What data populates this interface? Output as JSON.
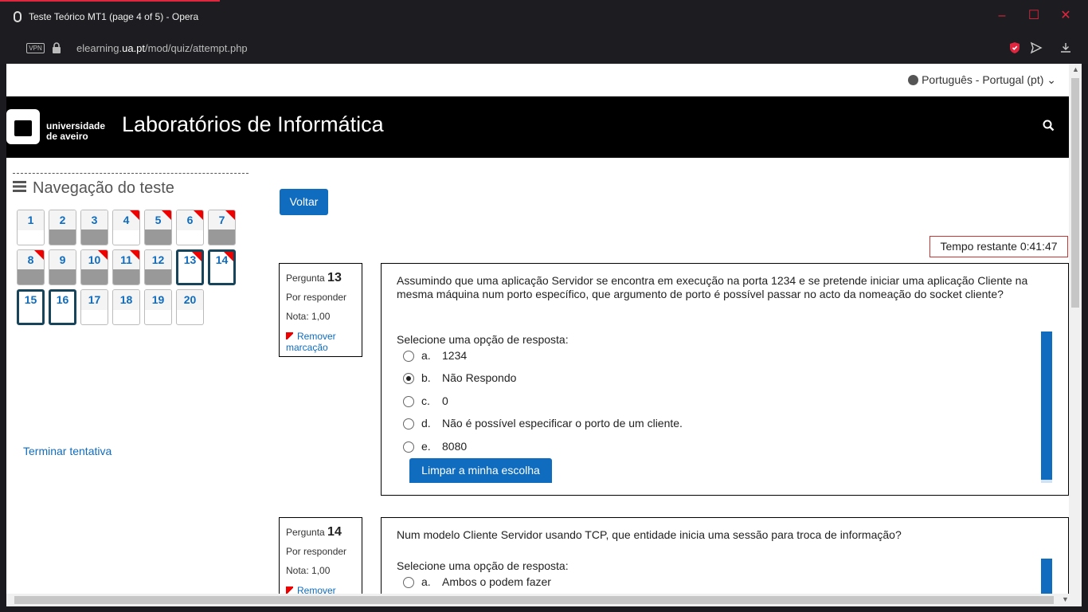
{
  "window": {
    "title": "Teste Teórico MT1 (page 4 of 5) - Opera",
    "controls": [
      "minimize",
      "maximize",
      "close"
    ]
  },
  "browser": {
    "vpn_label": "VPN",
    "url_host": "elearning.",
    "url_domain": "ua.pt",
    "url_path": "/mod/quiz/attempt.php"
  },
  "colors": {
    "accent": "#0f6cbf",
    "opera_red": "#e0253e",
    "header_bg": "#000000",
    "answered_fill": "#999999",
    "flag": "#ee0000"
  },
  "lang_menu": {
    "label": "Português - Portugal (pt)"
  },
  "header": {
    "logo_line1": "universidade",
    "logo_line2": "de aveiro",
    "site_title": "Laboratórios de Informática"
  },
  "quiz_nav": {
    "title": "Navegação do teste",
    "finish_link": "Terminar tentativa",
    "buttons": [
      {
        "n": "1",
        "answered": false,
        "flagged": false,
        "current": false
      },
      {
        "n": "2",
        "answered": true,
        "flagged": false,
        "current": false
      },
      {
        "n": "3",
        "answered": true,
        "flagged": false,
        "current": false
      },
      {
        "n": "4",
        "answered": false,
        "flagged": true,
        "current": false
      },
      {
        "n": "5",
        "answered": true,
        "flagged": true,
        "current": false
      },
      {
        "n": "6",
        "answered": false,
        "flagged": true,
        "current": false
      },
      {
        "n": "7",
        "answered": true,
        "flagged": true,
        "current": false
      },
      {
        "n": "8",
        "answered": true,
        "flagged": true,
        "current": false
      },
      {
        "n": "9",
        "answered": true,
        "flagged": false,
        "current": false
      },
      {
        "n": "10",
        "answered": true,
        "flagged": true,
        "current": false
      },
      {
        "n": "11",
        "answered": true,
        "flagged": true,
        "current": false
      },
      {
        "n": "12",
        "answered": true,
        "flagged": false,
        "current": false
      },
      {
        "n": "13",
        "answered": false,
        "flagged": true,
        "current": true
      },
      {
        "n": "14",
        "answered": false,
        "flagged": true,
        "current": true
      },
      {
        "n": "15",
        "answered": false,
        "flagged": false,
        "current": true
      },
      {
        "n": "16",
        "answered": false,
        "flagged": false,
        "current": true
      },
      {
        "n": "17",
        "answered": false,
        "flagged": false,
        "current": false
      },
      {
        "n": "18",
        "answered": false,
        "flagged": false,
        "current": false
      },
      {
        "n": "19",
        "answered": false,
        "flagged": false,
        "current": false
      },
      {
        "n": "20",
        "answered": false,
        "flagged": false,
        "current": false
      }
    ]
  },
  "back_button": "Voltar",
  "timer": "Tempo restante 0:41:47",
  "questions": [
    {
      "label": "Pergunta",
      "number": "13",
      "state": "Por responder",
      "grade": "Nota: 1,00",
      "flag_action_1": "Remover",
      "flag_action_2": "marcação",
      "text": "Assumindo que uma aplicação Servidor se encontra em execução na porta 1234 e se pretende iniciar uma aplicação Cliente na mesma máquina num porto específico, que argumento de porto é possível passar no acto da nomeação do socket cliente?",
      "prompt": "Selecione uma opção de resposta:",
      "options": [
        {
          "letter": "a.",
          "text": "1234",
          "checked": false
        },
        {
          "letter": "b.",
          "text": "Não Respondo",
          "checked": true
        },
        {
          "letter": "c.",
          "text": "0",
          "checked": false
        },
        {
          "letter": "d.",
          "text": "Não é possível especificar o porto de um cliente.",
          "checked": false
        },
        {
          "letter": "e.",
          "text": "8080",
          "checked": false
        }
      ],
      "clear_label": "Limpar a minha escolha"
    },
    {
      "label": "Pergunta",
      "number": "14",
      "state": "Por responder",
      "grade": "Nota: 1,00",
      "flag_action_1": "Remover",
      "text": "Num modelo Cliente Servidor usando TCP, que entidade inicia uma sessão para troca de informação?",
      "prompt": "Selecione uma opção de resposta:",
      "options": [
        {
          "letter": "a.",
          "text": "Ambos o podem fazer",
          "checked": false
        }
      ]
    }
  ]
}
